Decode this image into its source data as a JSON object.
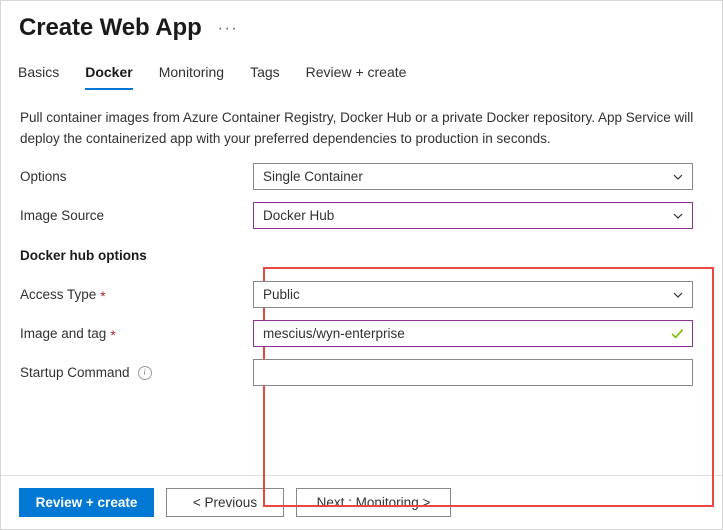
{
  "header": {
    "title": "Create Web App",
    "ellipsis": "···"
  },
  "tabs": [
    {
      "label": "Basics",
      "active": false
    },
    {
      "label": "Docker",
      "active": true
    },
    {
      "label": "Monitoring",
      "active": false
    },
    {
      "label": "Tags",
      "active": false
    },
    {
      "label": "Review + create",
      "active": false
    }
  ],
  "main": {
    "description": "Pull container images from Azure Container Registry, Docker Hub or a private Docker repository. App Service will deploy the containerized app with your preferred dependencies to production in seconds.",
    "section_heading": "Docker hub options",
    "fields": {
      "options": {
        "label": "Options",
        "value": "Single Container",
        "icon": "chevron-down-icon"
      },
      "image_source": {
        "label": "Image Source",
        "value": "Docker Hub",
        "icon": "chevron-down-icon"
      },
      "access_type": {
        "label": "Access Type",
        "required": "*",
        "value": "Public",
        "icon": "chevron-down-icon"
      },
      "image_and_tag": {
        "label": "Image and tag",
        "required": "*",
        "value": "mescius/wyn-enterprise",
        "placeholder": "",
        "icon": "checkmark-icon"
      },
      "startup_command": {
        "label": "Startup Command",
        "value": "",
        "placeholder": "",
        "icon": "info-icon",
        "info_glyph": "i"
      }
    }
  },
  "footer": {
    "review_create": "Review + create",
    "previous": "< Previous",
    "next": "Next : Monitoring >"
  },
  "colors": {
    "accent_blue": "#0078D4",
    "focus_purple": "#8A3391",
    "annotation_red": "#E8483F",
    "required_red": "#A4262C",
    "success_green": "#7FBA00"
  }
}
